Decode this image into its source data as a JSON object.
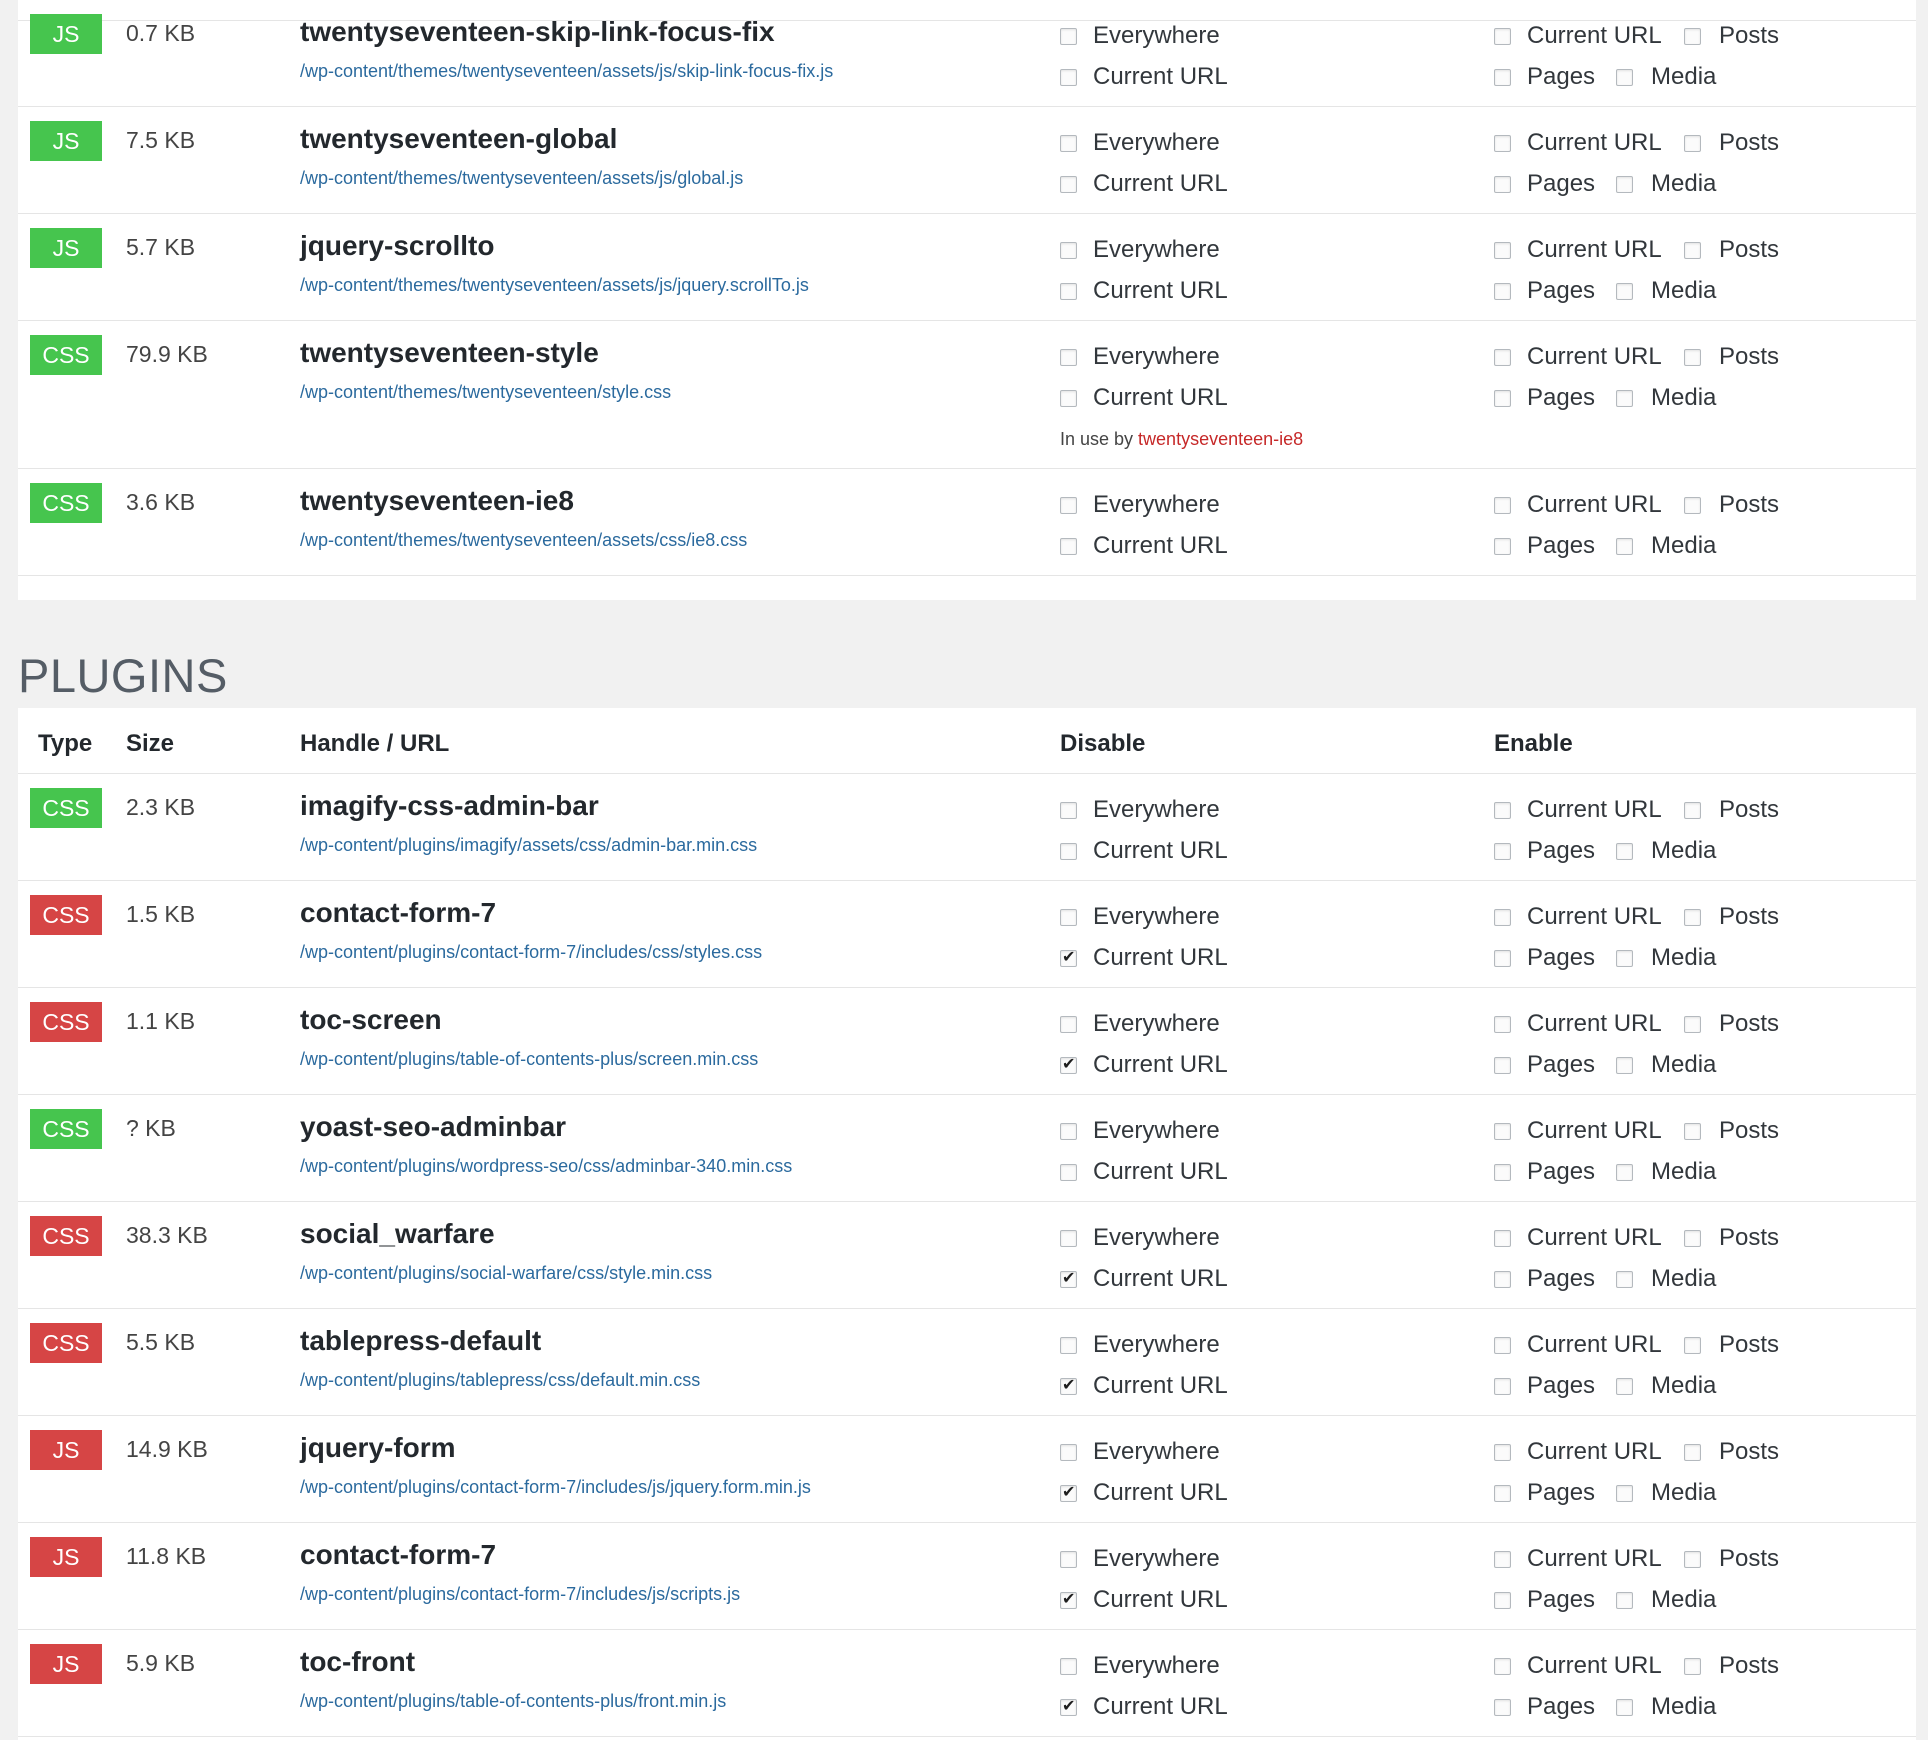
{
  "colors": {
    "loaded_badge": "#46c54e",
    "unloaded_badge": "#d64545",
    "url_link": "#2b6a9e",
    "inuse_link": "#c62828"
  },
  "labels": {
    "everywhere": "Everywhere",
    "current_url": "Current URL",
    "posts": "Posts",
    "pages": "Pages",
    "media": "Media",
    "in_use_by": "In use by"
  },
  "theme": {
    "rows": [
      {
        "type": "JS",
        "status": "loaded",
        "size": "0.7 KB",
        "handle": "twentyseventeen-skip-link-focus-fix",
        "url": "/wp-content/themes/twentyseventeen/assets/js/skip-link-focus-fix.js",
        "disable_everywhere": false,
        "disable_current": false
      },
      {
        "type": "JS",
        "status": "loaded",
        "size": "7.5 KB",
        "handle": "twentyseventeen-global",
        "url": "/wp-content/themes/twentyseventeen/assets/js/global.js",
        "disable_everywhere": false,
        "disable_current": false
      },
      {
        "type": "JS",
        "status": "loaded",
        "size": "5.7 KB",
        "handle": "jquery-scrollto",
        "url": "/wp-content/themes/twentyseventeen/assets/js/jquery.scrollTo.js",
        "disable_everywhere": false,
        "disable_current": false
      },
      {
        "type": "CSS",
        "status": "loaded",
        "size": "79.9 KB",
        "handle": "twentyseventeen-style",
        "url": "/wp-content/themes/twentyseventeen/style.css",
        "disable_everywhere": false,
        "disable_current": false,
        "in_use_by": "twentyseventeen-ie8"
      },
      {
        "type": "CSS",
        "status": "loaded",
        "size": "3.6 KB",
        "handle": "twentyseventeen-ie8",
        "url": "/wp-content/themes/twentyseventeen/assets/css/ie8.css",
        "disable_everywhere": false,
        "disable_current": false
      }
    ]
  },
  "plugins": {
    "title": "PLUGINS",
    "headers": {
      "type": "Type",
      "size": "Size",
      "handle": "Handle / URL",
      "disable": "Disable",
      "enable": "Enable"
    },
    "rows": [
      {
        "type": "CSS",
        "status": "loaded",
        "size": "2.3 KB",
        "handle": "imagify-css-admin-bar",
        "url": "/wp-content/plugins/imagify/assets/css/admin-bar.min.css",
        "disable_everywhere": false,
        "disable_current": false
      },
      {
        "type": "CSS",
        "status": "unloaded",
        "size": "1.5 KB",
        "handle": "contact-form-7",
        "url": "/wp-content/plugins/contact-form-7/includes/css/styles.css",
        "disable_everywhere": false,
        "disable_current": true
      },
      {
        "type": "CSS",
        "status": "unloaded",
        "size": "1.1 KB",
        "handle": "toc-screen",
        "url": "/wp-content/plugins/table-of-contents-plus/screen.min.css",
        "disable_everywhere": false,
        "disable_current": true
      },
      {
        "type": "CSS",
        "status": "loaded",
        "size": "? KB",
        "handle": "yoast-seo-adminbar",
        "url": "/wp-content/plugins/wordpress-seo/css/adminbar-340.min.css",
        "disable_everywhere": false,
        "disable_current": false
      },
      {
        "type": "CSS",
        "status": "unloaded",
        "size": "38.3 KB",
        "handle": "social_warfare",
        "url": "/wp-content/plugins/social-warfare/css/style.min.css",
        "disable_everywhere": false,
        "disable_current": true
      },
      {
        "type": "CSS",
        "status": "unloaded",
        "size": "5.5 KB",
        "handle": "tablepress-default",
        "url": "/wp-content/plugins/tablepress/css/default.min.css",
        "disable_everywhere": false,
        "disable_current": true
      },
      {
        "type": "JS",
        "status": "unloaded",
        "size": "14.9 KB",
        "handle": "jquery-form",
        "url": "/wp-content/plugins/contact-form-7/includes/js/jquery.form.min.js",
        "disable_everywhere": false,
        "disable_current": true
      },
      {
        "type": "JS",
        "status": "unloaded",
        "size": "11.8 KB",
        "handle": "contact-form-7",
        "url": "/wp-content/plugins/contact-form-7/includes/js/scripts.js",
        "disable_everywhere": false,
        "disable_current": true
      },
      {
        "type": "JS",
        "status": "unloaded",
        "size": "5.9 KB",
        "handle": "toc-front",
        "url": "/wp-content/plugins/table-of-contents-plus/front.min.js",
        "disable_everywhere": false,
        "disable_current": true
      }
    ]
  }
}
